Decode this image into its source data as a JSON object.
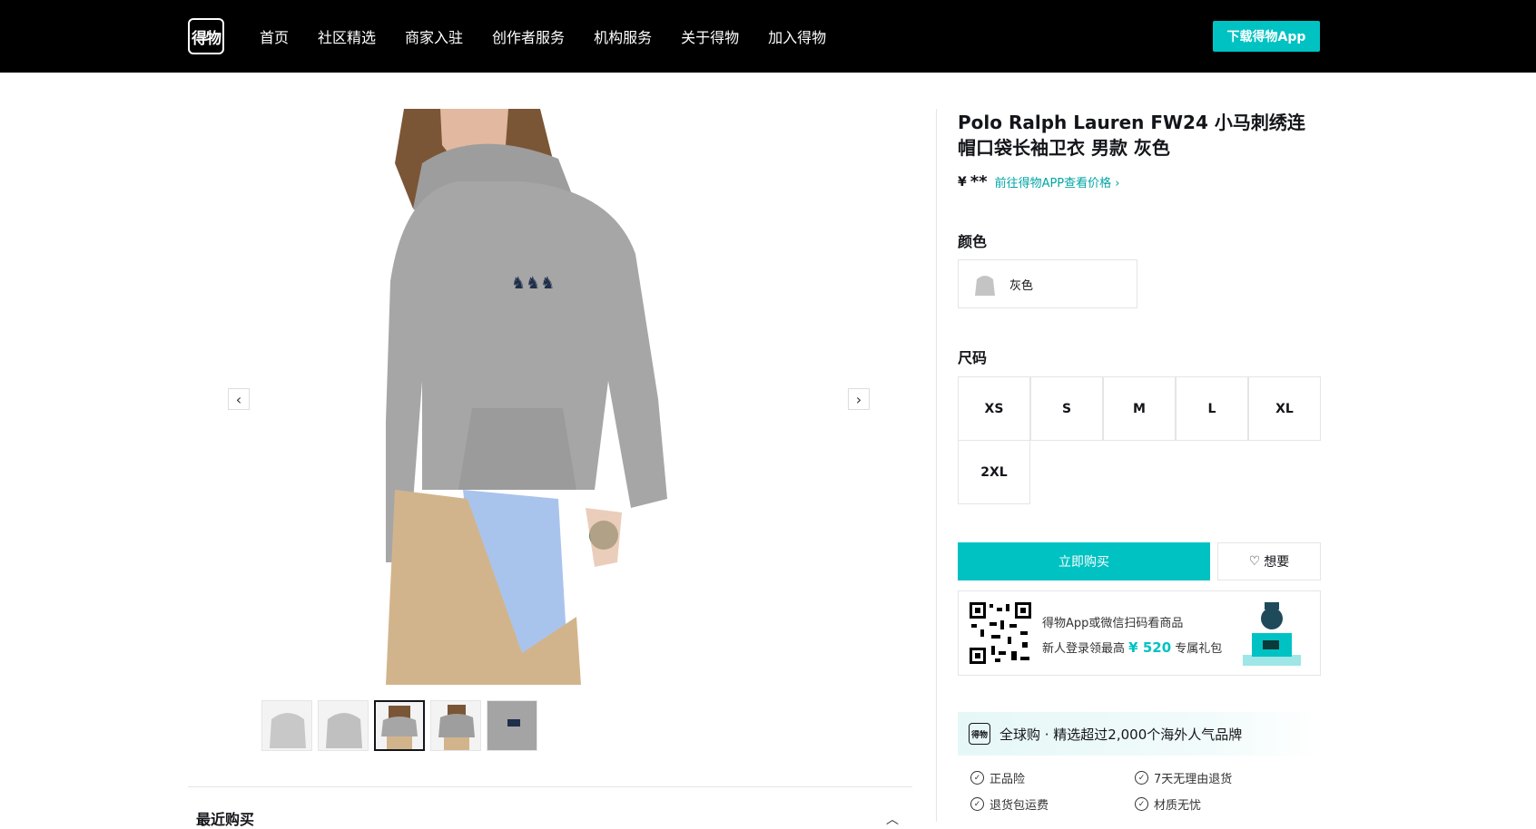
{
  "header": {
    "logo_text": "得物",
    "nav": [
      "首页",
      "社区精选",
      "商家入驻",
      "创作者服务",
      "机构服务",
      "关于得物",
      "加入得物"
    ],
    "download_label": "下载得物App"
  },
  "gallery": {
    "prev_icon": "‹",
    "next_icon": "›",
    "thumbnail_count": 5,
    "active_thumbnail": 3
  },
  "recent": {
    "label": "最近购买"
  },
  "product": {
    "title": "Polo Ralph Lauren FW24 小马刺绣连帽口袋长袖卫衣 男款 灰色",
    "price_symbol": "¥",
    "price_masked": "**",
    "price_link": "前往得物APP查看价格",
    "price_link_chevron": "›",
    "color_label": "颜色",
    "color_option": "灰色",
    "size_label": "尺码",
    "sizes": [
      "XS",
      "S",
      "M",
      "L",
      "XL",
      "2XL"
    ],
    "buy_label": "立即购买",
    "want_label": "想要",
    "heart_icon": "♡"
  },
  "promo": {
    "line1": "得物App或微信扫码看商品",
    "line2_prefix": "新人登录领最高",
    "line2_amount": "¥ 520",
    "line2_suffix": "专属礼包"
  },
  "banner": {
    "logo_text": "得物",
    "text": "全球购 · 精选超过2,000个海外人气品牌"
  },
  "guarantees": [
    "正品险",
    "7天无理由退货",
    "退货包运费",
    "材质无忧"
  ],
  "colors": {
    "accent": "#01c2c3",
    "link": "#01a5a6",
    "topbar": "#000000"
  }
}
